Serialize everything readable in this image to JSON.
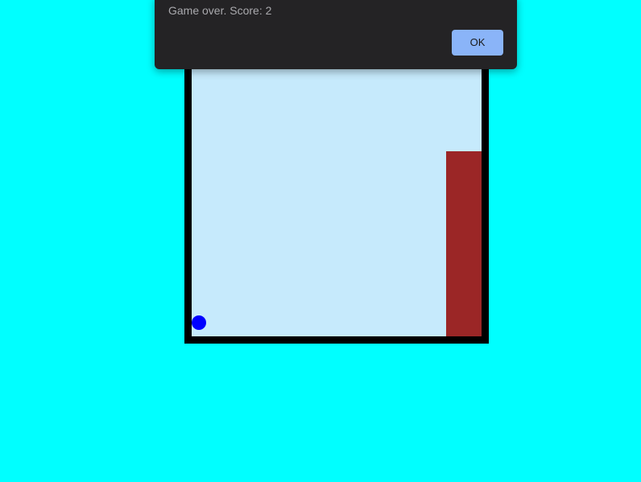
{
  "page": {
    "background_color": "#00ffff"
  },
  "game": {
    "frame_color": "#000000",
    "play_area_color": "#c6eafc",
    "obstacle_color": "#9b2626",
    "ball_color": "#0000ff"
  },
  "dialog": {
    "message": "Game over. Score: 2",
    "ok_label": "OK",
    "background_color": "#242325",
    "button_color": "#8ab4f8"
  }
}
